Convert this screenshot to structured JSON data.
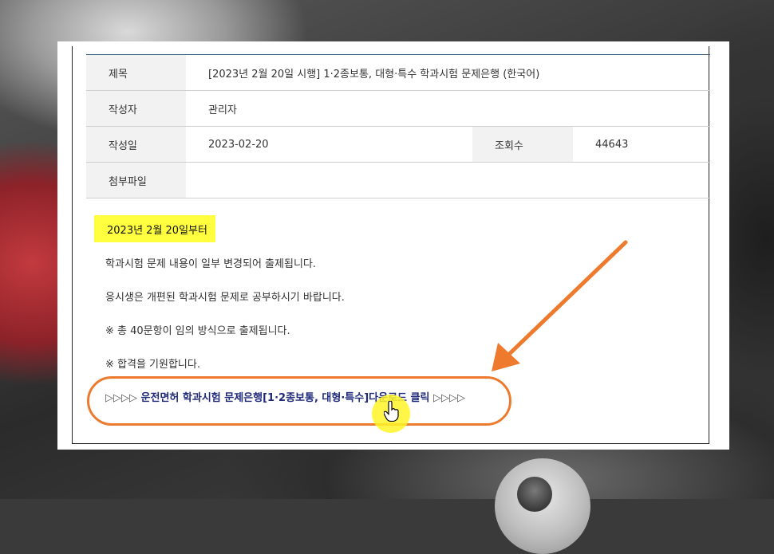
{
  "colors": {
    "highlight": "#ffff40",
    "link": "#1f2a7a",
    "annotation_orange": "#ee7a2e",
    "label_bg": "#f2f2f2"
  },
  "table": {
    "title_label": "제목",
    "title_value": "[2023년 2월 20일 시행] 1·2종보통, 대형·특수 학과시험 문제은행 (한국어)",
    "author_label": "작성자",
    "author_value": "관리자",
    "date_label": "작성일",
    "date_value": "2023-02-20",
    "views_label": "조회수",
    "views_value": "44643",
    "attachment_label": "첨부파일",
    "attachment_value": ""
  },
  "content": {
    "highlight_text": "2023년 2월 20일부터",
    "lines": [
      "학과시험 문제 내용이 일부 변경되어 출제됩니다.",
      "응시생은 개편된 학과시험 문제로 공부하시기 바랍니다.",
      "※ 총 40문항이 임의 방식으로 출제됩니다.",
      "※ 합격을 기원합니다."
    ],
    "download_prefix": "▷▷▷▷",
    "download_text": "운전면허 학과시험 문제은행[1·2종보통, 대형·특수]다운로드 클릭",
    "download_suffix": "▷▷▷▷"
  },
  "icons": {
    "cursor": "hand-pointer-icon",
    "arrow": "orange-arrow-annotation"
  }
}
